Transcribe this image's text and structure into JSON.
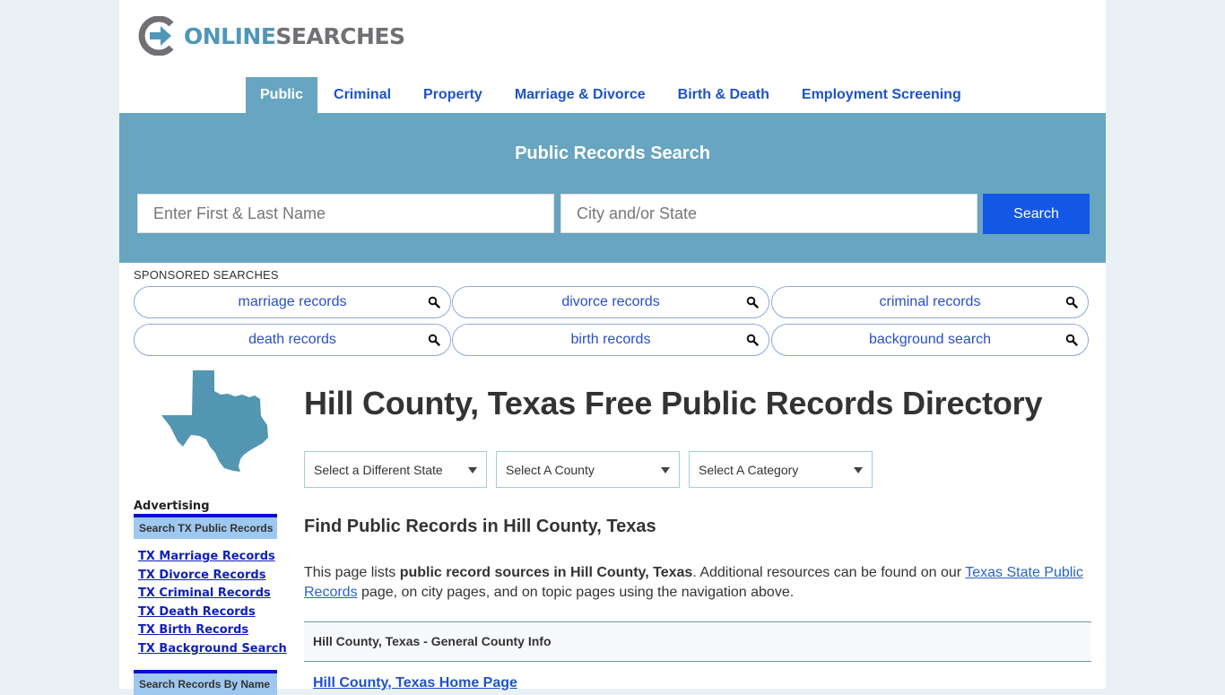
{
  "logo": {
    "part1": "ONLINE",
    "part2": "SEARCHES"
  },
  "nav": {
    "items": [
      {
        "label": "Public",
        "active": true
      },
      {
        "label": "Criminal",
        "active": false
      },
      {
        "label": "Property",
        "active": false
      },
      {
        "label": "Marriage & Divorce",
        "active": false
      },
      {
        "label": "Birth & Death",
        "active": false
      },
      {
        "label": "Employment Screening",
        "active": false
      }
    ]
  },
  "hero": {
    "title": "Public Records Search",
    "name_placeholder": "Enter First & Last Name",
    "location_placeholder": "City and/or State",
    "search_label": "Search"
  },
  "sponsored": {
    "label": "SPONSORED SEARCHES",
    "items": [
      {
        "label": "marriage records",
        "icon": "search-icon"
      },
      {
        "label": "divorce records",
        "icon": "search-icon"
      },
      {
        "label": "criminal records",
        "icon": "search-icon"
      },
      {
        "label": "death records",
        "icon": "search-icon"
      },
      {
        "label": "birth records",
        "icon": "search-icon"
      },
      {
        "label": "background search",
        "icon": "search-icon"
      }
    ]
  },
  "sidebar": {
    "map_icon": "texas-map-icon",
    "advertising_label": "Advertising",
    "box1_title": "Search TX Public Records",
    "links": [
      "TX Marriage Records",
      "TX Divorce Records",
      "TX Criminal Records",
      "TX Death Records",
      "TX Birth Records",
      "TX Background Search"
    ],
    "box2_title": "Search Records By Name"
  },
  "main": {
    "title": "Hill County, Texas Free Public Records Directory",
    "selects": [
      {
        "value": "Select a Different State"
      },
      {
        "value": "Select A County"
      },
      {
        "value": "Select A Category"
      }
    ],
    "subtitle": "Find Public Records in Hill County, Texas",
    "intro": {
      "pre": "This page lists ",
      "bold": "public record sources in Hill County, Texas",
      "mid": ". Additional resources can be found on our ",
      "link": "Texas State Public Records",
      "post": " page, on city pages, and on topic pages using the navigation above."
    },
    "section_header": "Hill County, Texas - General County Info",
    "first_link": "Hill County, Texas Home Page"
  },
  "colors": {
    "brand_blue": "#67a5c0",
    "nav_link": "#1f53c5",
    "search_button": "#1357e6",
    "sidebar_header": "#9ec8ef",
    "sidebar_border": "#0c0fc9",
    "sidebar_link": "#0f1fb9"
  }
}
